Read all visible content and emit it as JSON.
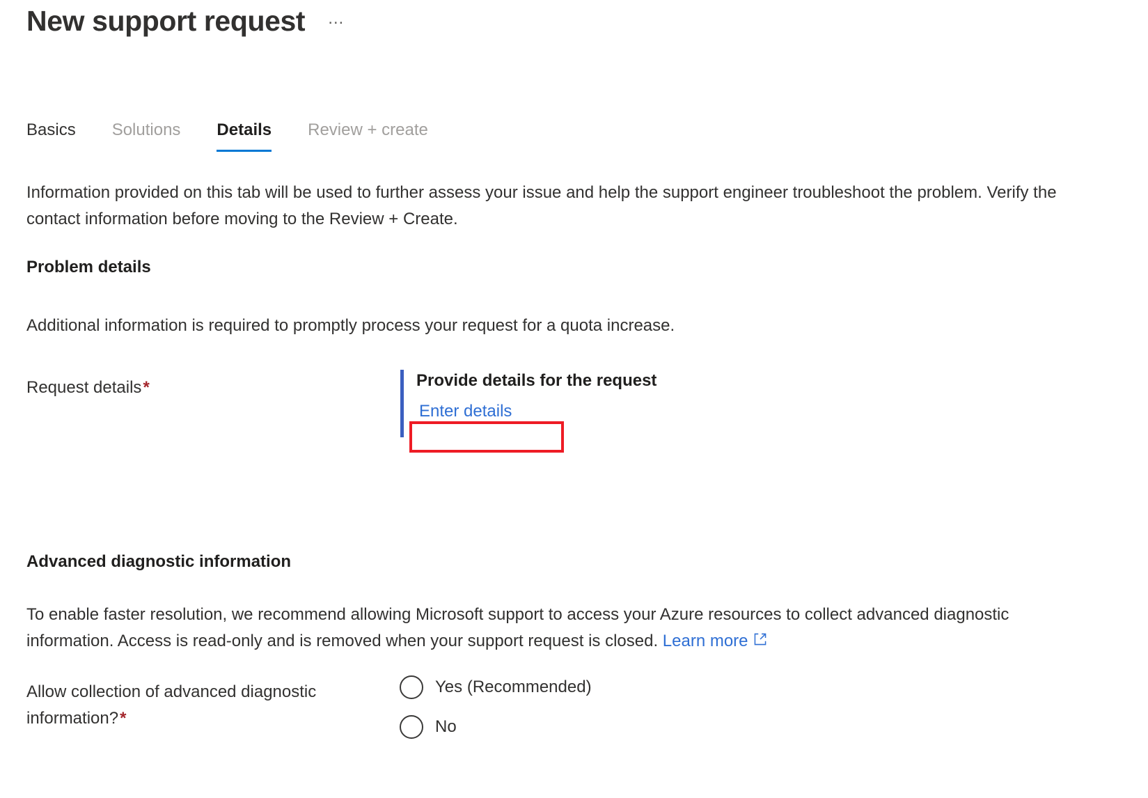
{
  "header": {
    "title": "New support request",
    "more_menu": "…"
  },
  "tabs": [
    {
      "label": "Basics",
      "state": "enabled"
    },
    {
      "label": "Solutions",
      "state": "disabled"
    },
    {
      "label": "Details",
      "state": "active"
    },
    {
      "label": "Review + create",
      "state": "disabled"
    }
  ],
  "intro": {
    "text": "Information provided on this tab will be used to further assess your issue and help the support engineer troubleshoot the problem. Verify the contact information before moving to the Review + Create."
  },
  "problem_details": {
    "heading": "Problem details",
    "description": "Additional information is required to promptly process your request for a quota increase.",
    "request_details": {
      "label": "Request details",
      "required_marker": "*",
      "control_heading": "Provide details for the request",
      "link_label": "Enter details"
    }
  },
  "advanced_diagnostic": {
    "heading": "Advanced diagnostic information",
    "description_before_link": "To enable faster resolution, we recommend allowing Microsoft support to access your Azure resources to collect advanced diagnostic information. Access is read-only and is removed when your support request is closed. ",
    "learn_more_label": "Learn more",
    "allow_collection": {
      "label": "Allow collection of advanced diagnostic information?",
      "required_marker": "*",
      "options": [
        {
          "label": "Yes (Recommended)",
          "checked": false
        },
        {
          "label": "No",
          "checked": false
        }
      ]
    }
  },
  "colors": {
    "accent_blue": "#0078d4",
    "link_blue": "#2f6fd4",
    "control_bar_blue": "#3b5fc0",
    "highlight_red": "#ee1c25",
    "required_red": "#a4262c",
    "text_primary": "#323130",
    "text_disabled": "#a19f9d"
  }
}
